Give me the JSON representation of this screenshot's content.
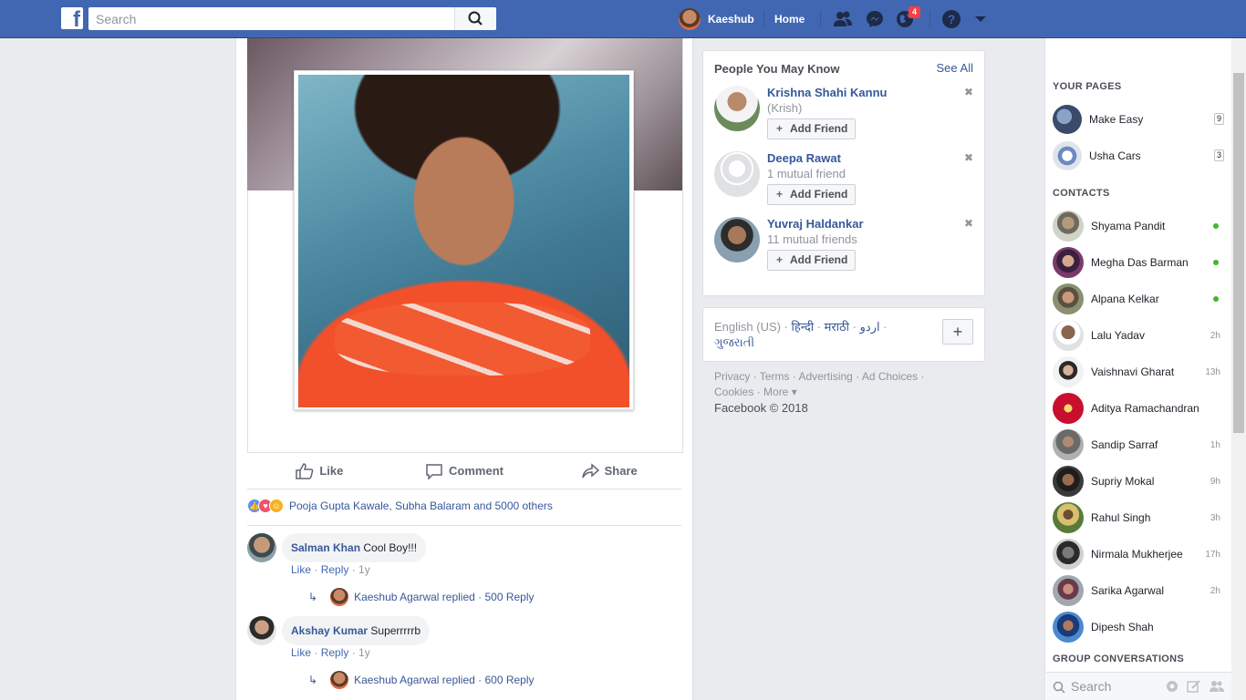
{
  "header": {
    "search_placeholder": "Search",
    "user_name": "Kaeshub",
    "home_label": "Home",
    "notification_count": "4"
  },
  "post": {
    "actions": {
      "like": "Like",
      "comment": "Comment",
      "share": "Share"
    },
    "reactions_text": "Pooja Gupta Kawale, Subha Balaram and 5000 others",
    "comments": [
      {
        "name": "Salman Khan",
        "text": "Cool Boy!!!",
        "like": "Like",
        "reply": "Reply",
        "age": "1y",
        "reply_summary": "Kaeshub Agarwal replied · 500 Reply"
      },
      {
        "name": "Akshay Kumar",
        "text": "Superrrrrb",
        "like": "Like",
        "reply": "Reply",
        "age": "1y",
        "reply_summary": "Kaeshub Agarwal replied · 600 Reply"
      }
    ]
  },
  "pymk": {
    "title": "People You May Know",
    "see_all": "See All",
    "add_friend": "Add Friend",
    "people": [
      {
        "name": "Krishna Shahi Kannu",
        "sub": "(Krish)"
      },
      {
        "name": "Deepa Rawat",
        "sub": "1 mutual friend"
      },
      {
        "name": "Yuvraj Haldankar",
        "sub": "11 mutual friends"
      }
    ]
  },
  "languages": {
    "current": "English (US) ·",
    "options": [
      "हिन्दी",
      "मराठी",
      "اردو",
      "ગુજરાતી"
    ],
    "plus": "+"
  },
  "footer": {
    "line1": "Privacy · Terms · Advertising · Ad Choices ·",
    "line2": "Cookies · More ▾",
    "copyright": "Facebook © 2018"
  },
  "sidebar": {
    "pages_heading": "YOUR PAGES",
    "pages": [
      {
        "name": "Make Easy",
        "count": "9"
      },
      {
        "name": "Usha Cars",
        "count": "3"
      }
    ],
    "contacts_heading": "CONTACTS",
    "contacts": [
      {
        "name": "Shyama Pandit",
        "status": "online"
      },
      {
        "name": "Megha Das Barman",
        "status": "online"
      },
      {
        "name": "Alpana Kelkar",
        "status": "online"
      },
      {
        "name": "Lalu Yadav",
        "status": "2h"
      },
      {
        "name": "Vaishnavi Gharat",
        "status": "13h"
      },
      {
        "name": "Aditya Ramachandran",
        "status": ""
      },
      {
        "name": "Sandip Sarraf",
        "status": "1h"
      },
      {
        "name": "Supriy Mokal",
        "status": "9h"
      },
      {
        "name": "Rahul Singh",
        "status": "3h"
      },
      {
        "name": "Nirmala Mukherjee",
        "status": "17h"
      },
      {
        "name": "Sarika Agarwal",
        "status": "2h"
      },
      {
        "name": "Dipesh Shah",
        "status": ""
      }
    ],
    "group_heading": "GROUP CONVERSATIONS",
    "search_placeholder": "Search"
  },
  "colors": {
    "brand": "#4267b2",
    "link": "#365899",
    "online": "#42b72a",
    "badge": "#fa3e3e"
  }
}
